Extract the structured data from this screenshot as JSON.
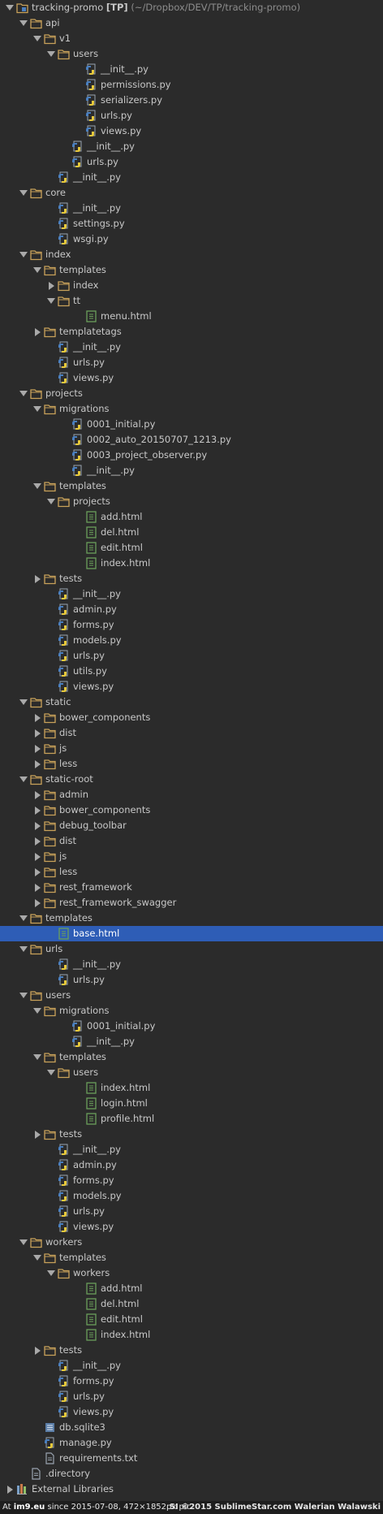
{
  "project": {
    "name": "tracking-promo",
    "tag": "[TP]",
    "path": "(~/Dropbox/DEV/TP/tracking-promo)"
  },
  "tree": [
    {
      "depth": 0,
      "type": "project",
      "state": "open",
      "label": "tracking-promo [TP]"
    },
    {
      "depth": 1,
      "type": "folder",
      "state": "open",
      "label": "api"
    },
    {
      "depth": 2,
      "type": "folder",
      "state": "open",
      "label": "v1"
    },
    {
      "depth": 3,
      "type": "folder",
      "state": "open",
      "label": "users"
    },
    {
      "depth": 5,
      "type": "python",
      "label": "__init__.py"
    },
    {
      "depth": 5,
      "type": "python",
      "label": "permissions.py"
    },
    {
      "depth": 5,
      "type": "python",
      "label": "serializers.py"
    },
    {
      "depth": 5,
      "type": "python",
      "label": "urls.py"
    },
    {
      "depth": 5,
      "type": "python",
      "label": "views.py"
    },
    {
      "depth": 4,
      "type": "python",
      "label": "__init__.py"
    },
    {
      "depth": 4,
      "type": "python",
      "label": "urls.py"
    },
    {
      "depth": 3,
      "type": "python",
      "label": "__init__.py"
    },
    {
      "depth": 1,
      "type": "folder",
      "state": "open",
      "label": "core"
    },
    {
      "depth": 3,
      "type": "python",
      "label": "__init__.py"
    },
    {
      "depth": 3,
      "type": "python",
      "label": "settings.py"
    },
    {
      "depth": 3,
      "type": "python",
      "label": "wsgi.py"
    },
    {
      "depth": 1,
      "type": "folder",
      "state": "open",
      "label": "index"
    },
    {
      "depth": 2,
      "type": "folder",
      "state": "open",
      "label": "templates"
    },
    {
      "depth": 3,
      "type": "folder",
      "state": "closed",
      "label": "index"
    },
    {
      "depth": 3,
      "type": "folder",
      "state": "open",
      "label": "tt"
    },
    {
      "depth": 5,
      "type": "html",
      "label": "menu.html"
    },
    {
      "depth": 2,
      "type": "folder",
      "state": "closed",
      "label": "templatetags"
    },
    {
      "depth": 3,
      "type": "python",
      "label": "__init__.py"
    },
    {
      "depth": 3,
      "type": "python",
      "label": "urls.py"
    },
    {
      "depth": 3,
      "type": "python",
      "label": "views.py"
    },
    {
      "depth": 1,
      "type": "folder",
      "state": "open",
      "label": "projects"
    },
    {
      "depth": 2,
      "type": "folder",
      "state": "open",
      "label": "migrations"
    },
    {
      "depth": 4,
      "type": "python",
      "label": "0001_initial.py"
    },
    {
      "depth": 4,
      "type": "python",
      "label": "0002_auto_20150707_1213.py"
    },
    {
      "depth": 4,
      "type": "python",
      "label": "0003_project_observer.py"
    },
    {
      "depth": 4,
      "type": "python",
      "label": "__init__.py"
    },
    {
      "depth": 2,
      "type": "folder",
      "state": "open",
      "label": "templates"
    },
    {
      "depth": 3,
      "type": "folder",
      "state": "open",
      "label": "projects"
    },
    {
      "depth": 5,
      "type": "html",
      "label": "add.html"
    },
    {
      "depth": 5,
      "type": "html",
      "label": "del.html"
    },
    {
      "depth": 5,
      "type": "html",
      "label": "edit.html"
    },
    {
      "depth": 5,
      "type": "html",
      "label": "index.html"
    },
    {
      "depth": 2,
      "type": "folder",
      "state": "closed",
      "label": "tests"
    },
    {
      "depth": 3,
      "type": "python",
      "label": "__init__.py"
    },
    {
      "depth": 3,
      "type": "python",
      "label": "admin.py"
    },
    {
      "depth": 3,
      "type": "python",
      "label": "forms.py"
    },
    {
      "depth": 3,
      "type": "python",
      "label": "models.py"
    },
    {
      "depth": 3,
      "type": "python",
      "label": "urls.py"
    },
    {
      "depth": 3,
      "type": "python",
      "label": "utils.py"
    },
    {
      "depth": 3,
      "type": "python",
      "label": "views.py"
    },
    {
      "depth": 1,
      "type": "folder",
      "state": "open",
      "label": "static"
    },
    {
      "depth": 2,
      "type": "folder",
      "state": "closed",
      "label": "bower_components"
    },
    {
      "depth": 2,
      "type": "folder",
      "state": "closed",
      "label": "dist"
    },
    {
      "depth": 2,
      "type": "folder",
      "state": "closed",
      "label": "js"
    },
    {
      "depth": 2,
      "type": "folder",
      "state": "closed",
      "label": "less"
    },
    {
      "depth": 1,
      "type": "folder",
      "state": "open",
      "label": "static-root"
    },
    {
      "depth": 2,
      "type": "folder",
      "state": "closed",
      "label": "admin"
    },
    {
      "depth": 2,
      "type": "folder",
      "state": "closed",
      "label": "bower_components"
    },
    {
      "depth": 2,
      "type": "folder",
      "state": "closed",
      "label": "debug_toolbar"
    },
    {
      "depth": 2,
      "type": "folder",
      "state": "closed",
      "label": "dist"
    },
    {
      "depth": 2,
      "type": "folder",
      "state": "closed",
      "label": "js"
    },
    {
      "depth": 2,
      "type": "folder",
      "state": "closed",
      "label": "less"
    },
    {
      "depth": 2,
      "type": "folder",
      "state": "closed",
      "label": "rest_framework"
    },
    {
      "depth": 2,
      "type": "folder",
      "state": "closed",
      "label": "rest_framework_swagger"
    },
    {
      "depth": 1,
      "type": "folder",
      "state": "open",
      "label": "templates"
    },
    {
      "depth": 3,
      "type": "html",
      "label": "base.html",
      "selected": true
    },
    {
      "depth": 1,
      "type": "folder",
      "state": "open",
      "label": "urls"
    },
    {
      "depth": 3,
      "type": "python",
      "label": "__init__.py"
    },
    {
      "depth": 3,
      "type": "python",
      "label": "urls.py"
    },
    {
      "depth": 1,
      "type": "folder",
      "state": "open",
      "label": "users"
    },
    {
      "depth": 2,
      "type": "folder",
      "state": "open",
      "label": "migrations"
    },
    {
      "depth": 4,
      "type": "python",
      "label": "0001_initial.py"
    },
    {
      "depth": 4,
      "type": "python",
      "label": "__init__.py"
    },
    {
      "depth": 2,
      "type": "folder",
      "state": "open",
      "label": "templates"
    },
    {
      "depth": 3,
      "type": "folder",
      "state": "open",
      "label": "users"
    },
    {
      "depth": 5,
      "type": "html",
      "label": "index.html"
    },
    {
      "depth": 5,
      "type": "html",
      "label": "login.html"
    },
    {
      "depth": 5,
      "type": "html",
      "label": "profile.html"
    },
    {
      "depth": 2,
      "type": "folder",
      "state": "closed",
      "label": "tests"
    },
    {
      "depth": 3,
      "type": "python",
      "label": "__init__.py"
    },
    {
      "depth": 3,
      "type": "python",
      "label": "admin.py"
    },
    {
      "depth": 3,
      "type": "python",
      "label": "forms.py"
    },
    {
      "depth": 3,
      "type": "python",
      "label": "models.py"
    },
    {
      "depth": 3,
      "type": "python",
      "label": "urls.py"
    },
    {
      "depth": 3,
      "type": "python",
      "label": "views.py"
    },
    {
      "depth": 1,
      "type": "folder",
      "state": "open",
      "label": "workers"
    },
    {
      "depth": 2,
      "type": "folder",
      "state": "open",
      "label": "templates"
    },
    {
      "depth": 3,
      "type": "folder",
      "state": "open",
      "label": "workers"
    },
    {
      "depth": 5,
      "type": "html",
      "label": "add.html"
    },
    {
      "depth": 5,
      "type": "html",
      "label": "del.html"
    },
    {
      "depth": 5,
      "type": "html",
      "label": "edit.html"
    },
    {
      "depth": 5,
      "type": "html",
      "label": "index.html"
    },
    {
      "depth": 2,
      "type": "folder",
      "state": "closed",
      "label": "tests"
    },
    {
      "depth": 3,
      "type": "python",
      "label": "__init__.py"
    },
    {
      "depth": 3,
      "type": "python",
      "label": "forms.py"
    },
    {
      "depth": 3,
      "type": "python",
      "label": "urls.py"
    },
    {
      "depth": 3,
      "type": "python",
      "label": "views.py"
    },
    {
      "depth": 2,
      "type": "database",
      "label": "db.sqlite3"
    },
    {
      "depth": 2,
      "type": "python",
      "label": "manage.py"
    },
    {
      "depth": 2,
      "type": "text",
      "label": "requirements.txt"
    },
    {
      "depth": 1,
      "type": "text",
      "label": ".directory"
    },
    {
      "depth": 0,
      "type": "library",
      "state": "closed",
      "label": "External Libraries"
    }
  ],
  "statusbar": {
    "prefix": "At",
    "host": "im9.eu",
    "left": "since 2015-07-08, 472×1852px pic.",
    "right": "SI ©2015 SublimeStar.com Walerian Walawski"
  },
  "colors": {
    "background": "#2b2b2b",
    "selection": "#2e5db6",
    "folder": "#c9a25a",
    "python_blue": "#4a7fbf",
    "python_yellow": "#e7c93c",
    "html_green": "#6a9f5a"
  }
}
